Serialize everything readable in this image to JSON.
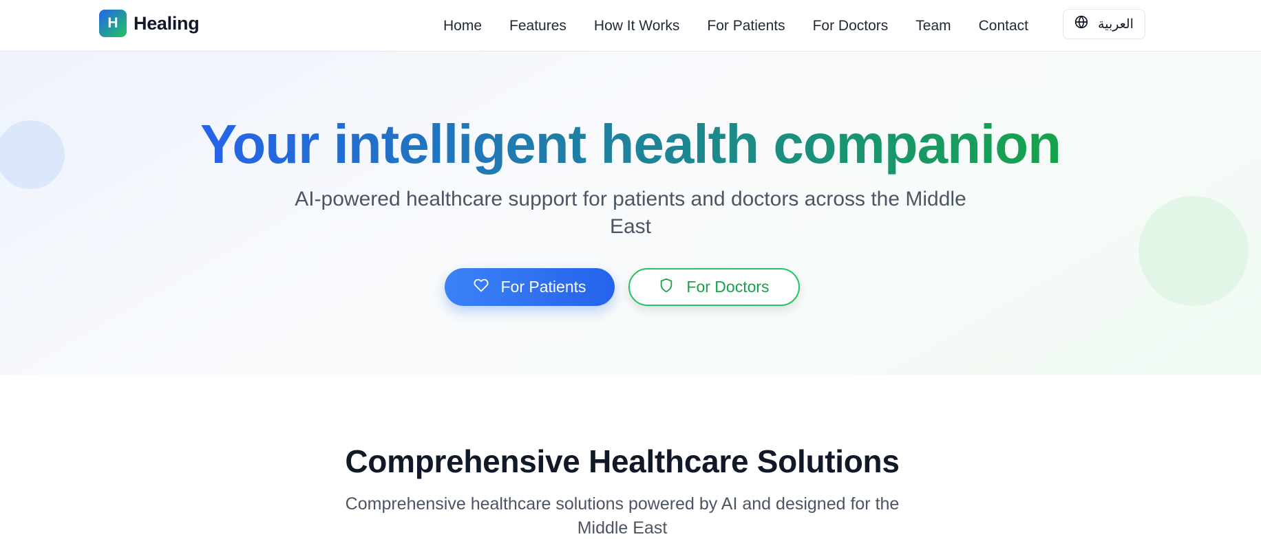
{
  "brand": {
    "logo_letter": "H",
    "name": "Healing"
  },
  "nav": {
    "links": [
      "Home",
      "Features",
      "How It Works",
      "For Patients",
      "For Doctors",
      "Team",
      "Contact"
    ],
    "language_button": {
      "label": "العربية",
      "icon": "globe-icon"
    }
  },
  "hero": {
    "title": "Your intelligent health companion",
    "subtitle": "AI-powered healthcare support for patients and doctors across the Middle East",
    "primary_button": {
      "label": "For Patients",
      "icon": "heart-icon"
    },
    "secondary_button": {
      "label": "For Doctors",
      "icon": "shield-icon"
    }
  },
  "solutions": {
    "title": "Comprehensive Healthcare Solutions",
    "subtitle": "Comprehensive healthcare solutions powered by AI and designed for the Middle East"
  },
  "colors": {
    "primary_blue": "#2563eb",
    "primary_green": "#16a34a",
    "text_dark": "#111827",
    "text_muted": "#4b5563"
  }
}
